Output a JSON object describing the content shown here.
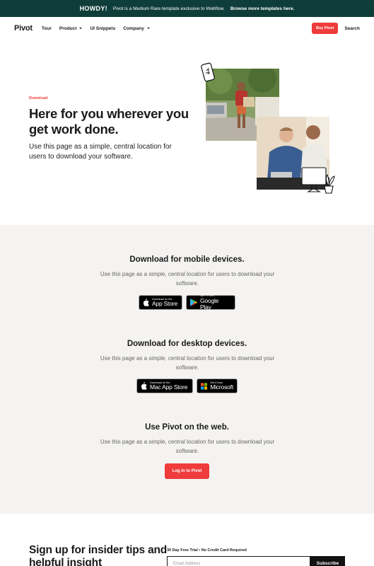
{
  "banner": {
    "howdy": "HOWDY!",
    "text": "Pivot is a Medium Rare template exclusive to Webflow.",
    "link": "Browse more templates here."
  },
  "nav": {
    "logo": "Pivot",
    "items": [
      {
        "label": "Tour",
        "dropdown": false
      },
      {
        "label": "Product",
        "dropdown": true
      },
      {
        "label": "UI Snippets",
        "dropdown": false
      },
      {
        "label": "Company",
        "dropdown": true
      }
    ],
    "buy_label": "Buy Pivot",
    "search_label": "Search"
  },
  "hero": {
    "eyebrow": "Download",
    "title": "Here for you wherever you get work done.",
    "subtitle": "Use this page as a simple, central location for users to download your software."
  },
  "mobile": {
    "title": "Download for mobile devices.",
    "subtitle": "Use this page as a simple, central location for users to download your software.",
    "appstore": {
      "small": "Download on the",
      "big": "App Store"
    },
    "googleplay": {
      "small": "GET IT ON",
      "big": "Google Play"
    }
  },
  "desktop": {
    "title": "Download for desktop devices.",
    "subtitle": "Use this page as a simple, central location for users to download your software.",
    "macstore": {
      "small": "Download on the",
      "big": "Mac App Store"
    },
    "microsoft": {
      "small": "Get it from",
      "big": "Microsoft"
    }
  },
  "web": {
    "title": "Use Pivot on the web.",
    "subtitle": "Use this page as a simple, central location for users to download your software.",
    "login_label": "Log in to Pivot"
  },
  "signup": {
    "title": "Sign up for insider tips and helpful insight",
    "trial": "30 Day Free Trial • No Credit Card Required",
    "email_placeholder": "Email Address",
    "subscribe_label": "Subscribe"
  },
  "colors": {
    "accent": "#ef3b3b",
    "banner_bg": "#0f3d3a",
    "section_bg": "#f4f3f1"
  }
}
